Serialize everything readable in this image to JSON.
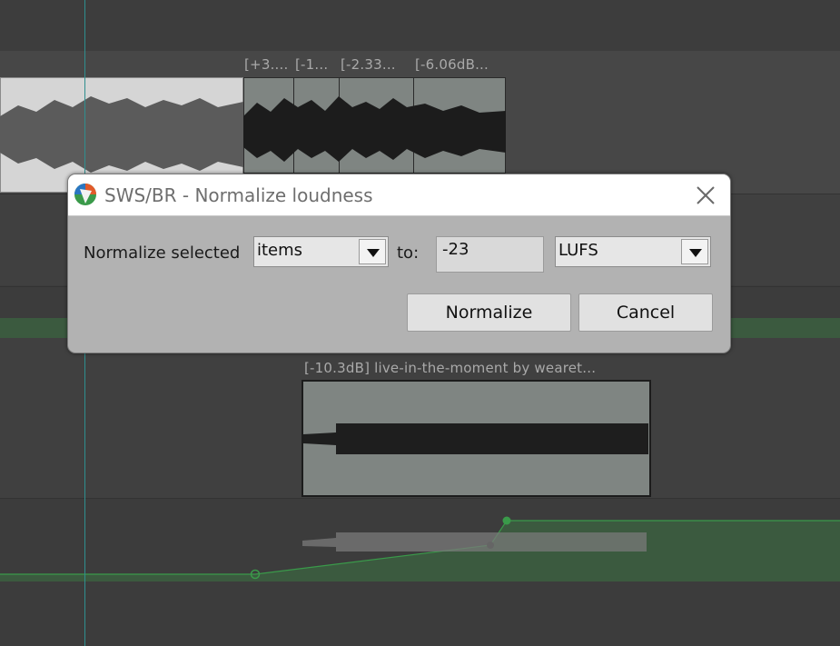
{
  "arrange": {
    "top_item_labels": [
      "[+3....",
      "[-1...",
      "[-2.33...",
      "[-6.06dB..."
    ],
    "bottom_item_label": "[-10.3dB] live-in-the-moment by wearet..."
  },
  "dialog": {
    "title": "SWS/BR - Normalize loudness",
    "normalize_label": "Normalize selected",
    "target_select_value": "items",
    "to_label": "to:",
    "level_value": "-23",
    "unit_select_value": "LUFS",
    "normalize_button": "Normalize",
    "cancel_button": "Cancel"
  },
  "colors": {
    "accent_green": "#3a9a4a",
    "cursor": "#2f8f8f",
    "dialog_bg": "#b2b2b2"
  }
}
